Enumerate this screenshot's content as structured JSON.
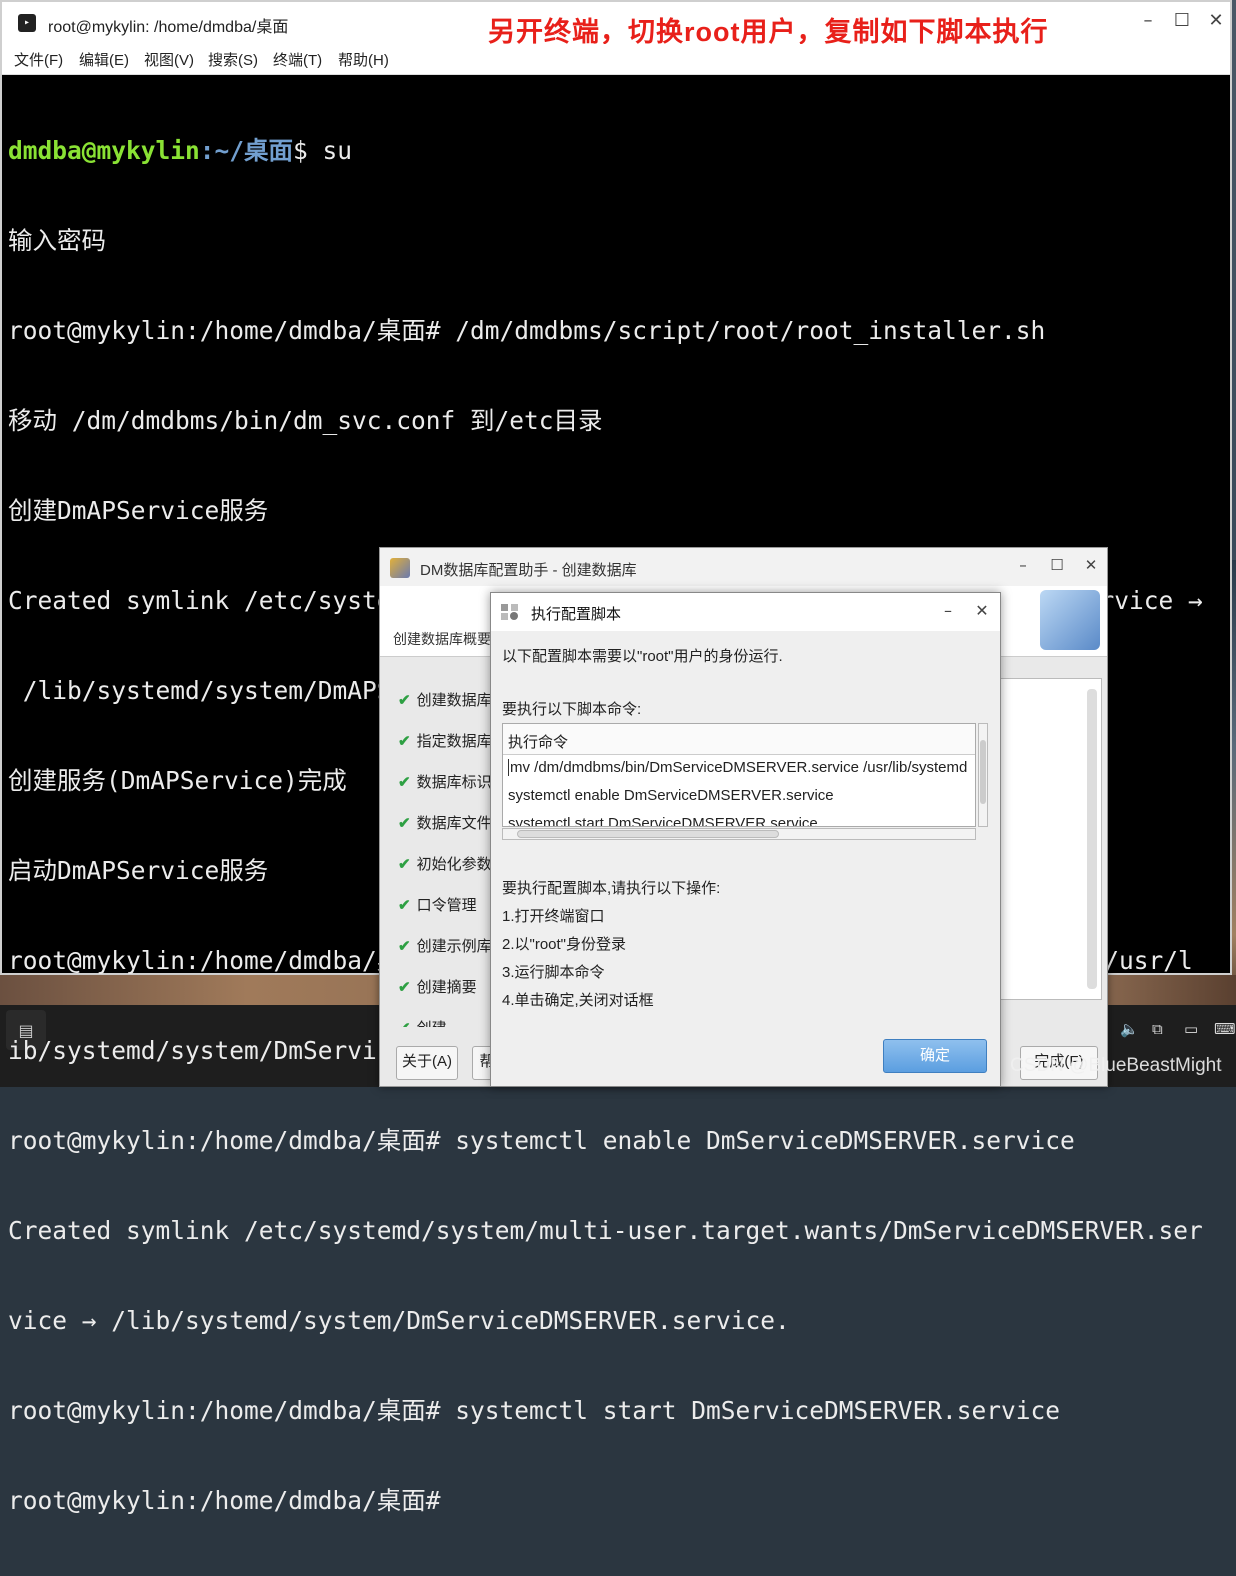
{
  "terminal": {
    "title": "root@mykylin: /home/dmdba/桌面",
    "annotation": "另开终端，切换root用户，复制如下脚本执行",
    "menu": [
      "文件(F)",
      "编辑(E)",
      "视图(V)",
      "搜索(S)",
      "终端(T)",
      "帮助(H)"
    ],
    "prompt_user": "dmdba@mykylin",
    "prompt_path": ":~/桌面",
    "prompt_cmd": "$ su",
    "lines": [
      "输入密码",
      "root@mykylin:/home/dmdba/桌面# /dm/dmdbms/script/root/root_installer.sh",
      "移动 /dm/dmdbms/bin/dm_svc.conf 到/etc目录",
      "创建DmAPService服务",
      "Created symlink /etc/systemd/system/multi-user.target.wants/DmAPService.service →",
      " /lib/systemd/system/DmAPService.service.",
      "创建服务(DmAPService)完成",
      "启动DmAPService服务",
      "root@mykylin:/home/dmdba/桌面# mv /dm/dmdbms/bin/DmServiceDMSERVER.service /usr/l",
      "ib/systemd/system/DmServiceDMSERVER.service",
      "root@mykylin:/home/dmdba/桌面# systemctl enable DmServiceDMSERVER.service",
      "Created symlink /etc/systemd/system/multi-user.target.wants/DmServiceDMSERVER.ser",
      "vice → /lib/systemd/system/DmServiceDMSERVER.service.",
      "root@mykylin:/home/dmdba/桌面# systemctl start DmServiceDMSERVER.service",
      "root@mykylin:/home/dmdba/桌面#"
    ]
  },
  "dm_window": {
    "title": "DM数据库配置助手 - 创建数据库",
    "header_label": "创建数据库概要",
    "steps": [
      "创建数据库",
      "指定数据库",
      "数据库标识",
      "数据库文件",
      "初始化参数",
      "口令管理",
      "创建示例库",
      "创建摘要",
      "创建"
    ],
    "buttons": {
      "about": "关于(A)",
      "help": "帮",
      "finish": "完成(F)"
    }
  },
  "dialog": {
    "title": "执行配置脚本",
    "intro": "以下配置脚本需要以\"root\"用户的身份运行.",
    "commands_label": "要执行以下脚本命令:",
    "column_header": "执行命令",
    "commands": [
      "mv /dm/dmdbms/bin/DmServiceDMSERVER.service /usr/lib/systemd",
      "systemctl enable DmServiceDMSERVER.service",
      "systemctl start DmServiceDMSERVER.service"
    ],
    "steps_title": "要执行配置脚本,请执行以下操作:",
    "steps": [
      "1.打开终端窗口",
      "2.以\"root\"身份登录",
      "3.运行脚本命令",
      "4.单击确定,关闭对话框"
    ],
    "ok_label": "确定"
  },
  "watermark": "CSDN @BlueBeastMight"
}
